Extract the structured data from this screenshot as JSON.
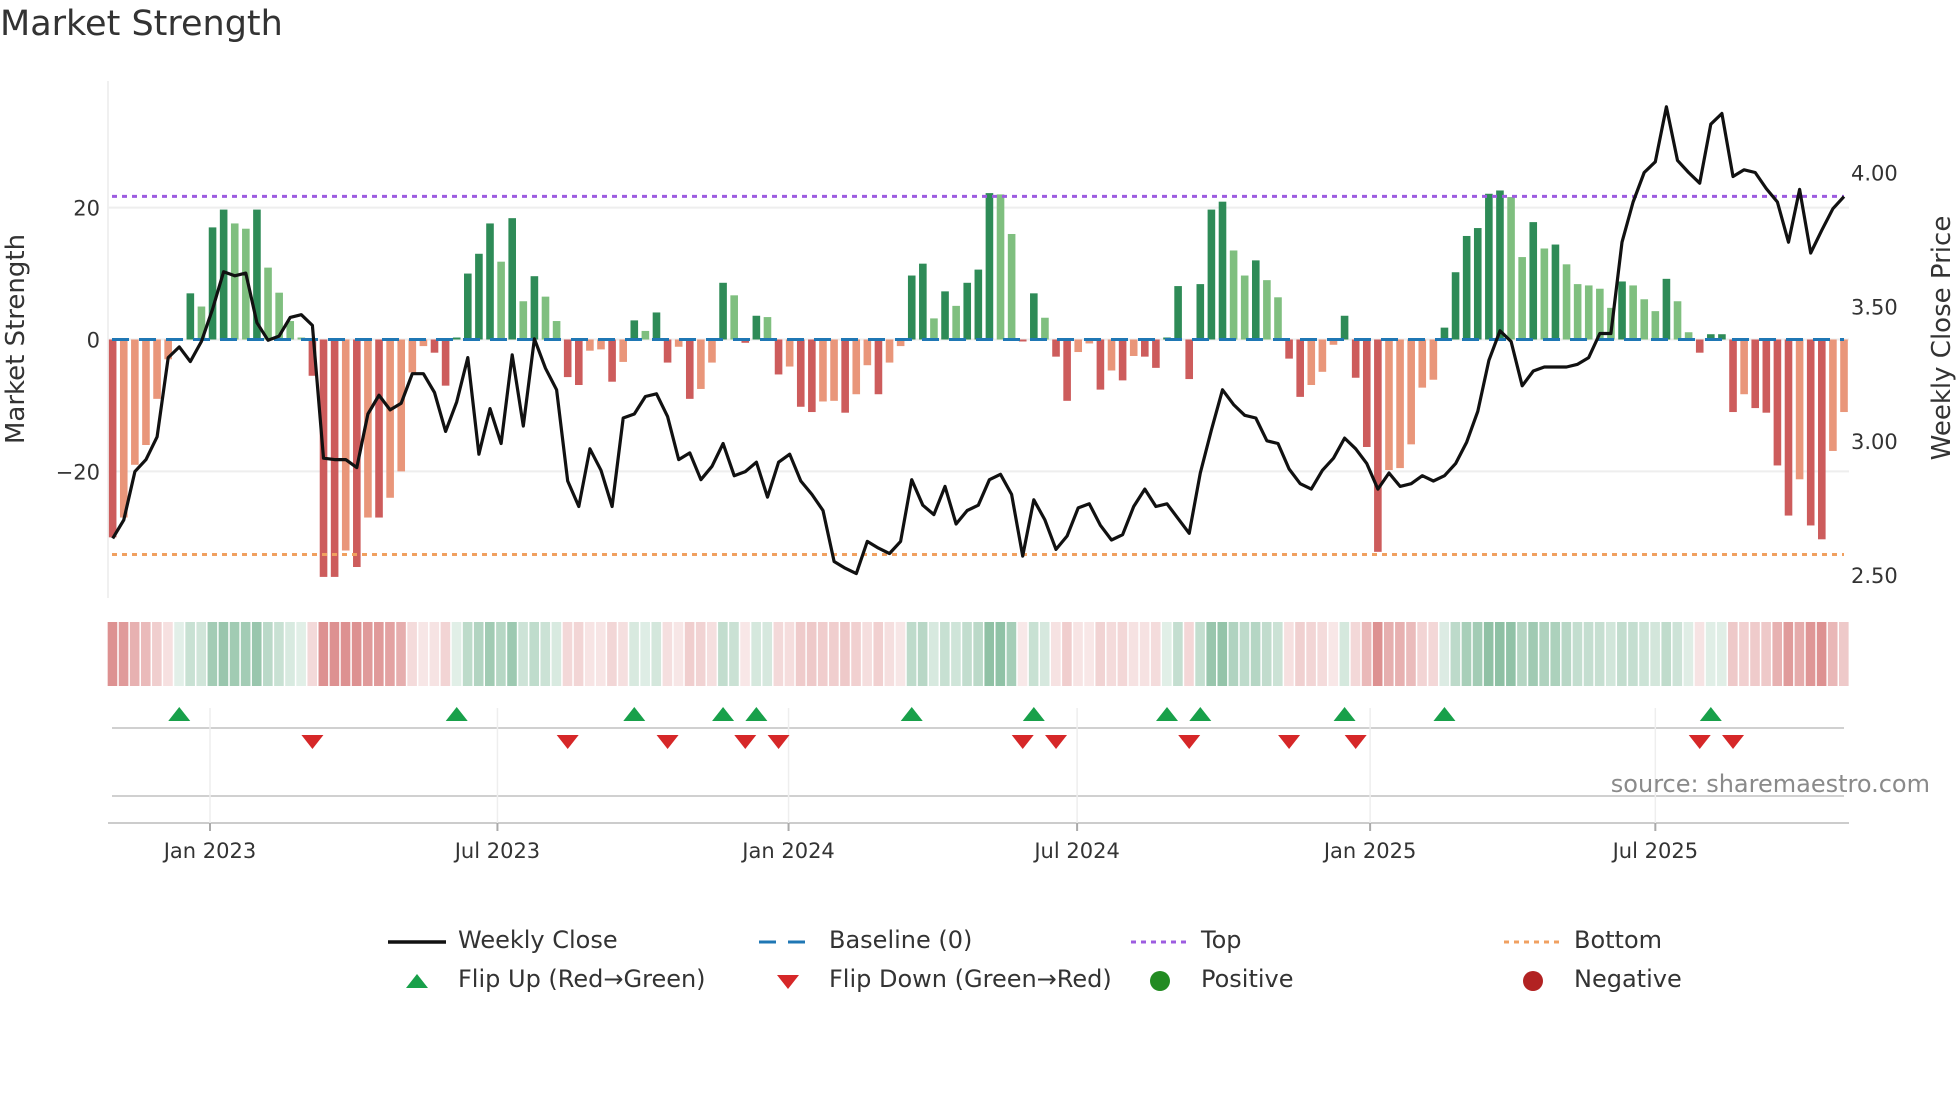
{
  "title": "Market Strength",
  "source": "source: sharemaestro.com",
  "colors": {
    "pos_strong": "#2e8b57",
    "pos_weak": "#7fbf7f",
    "neg_strong": "#cd5c5c",
    "neg_weak": "#e9967a",
    "line": "#111111",
    "baseline": "#1f77b4",
    "top": "#9d5ce0",
    "bottom": "#f0a060",
    "flip_up": "#18a04a",
    "flip_down": "#d62728",
    "positive": "#228b22",
    "negative": "#b22222"
  },
  "legend": [
    {
      "label": "Weekly Close",
      "kind": "line"
    },
    {
      "label": "Baseline (0)",
      "kind": "baseline"
    },
    {
      "label": "Top",
      "kind": "top"
    },
    {
      "label": "Bottom",
      "kind": "bottom"
    },
    {
      "label": "Flip Up (Red→Green)",
      "kind": "up"
    },
    {
      "label": "Flip Down (Green→Red)",
      "kind": "down"
    },
    {
      "label": "Positive",
      "kind": "pos"
    },
    {
      "label": "Negative",
      "kind": "neg"
    }
  ],
  "chart_data": {
    "type": "bar",
    "title": "Market Strength",
    "ylabel": "Market Strength",
    "ylabel_right": "Weekly Close Price",
    "ylim": [
      -39.2,
      39.2
    ],
    "ylim_right": [
      2.414,
      4.341
    ],
    "xlim_week_index": [
      -0.42,
      156.45
    ],
    "yticks": [
      {
        "v": 20,
        "label": "20"
      },
      {
        "v": 0,
        "label": "0"
      },
      {
        "v": -20,
        "label": "−20"
      }
    ],
    "yticks_right": [
      {
        "v": 4.0,
        "label": "4.00"
      },
      {
        "v": 3.5,
        "label": "3.50"
      },
      {
        "v": 3.0,
        "label": "3.00"
      },
      {
        "v": 2.5,
        "label": "2.50"
      }
    ],
    "xticks": [
      {
        "week": 8.77,
        "label": "Jan 2023"
      },
      {
        "week": 34.67,
        "label": "Jul 2023"
      },
      {
        "week": 60.9,
        "label": "Jan 2024"
      },
      {
        "week": 86.9,
        "label": "Jul 2024"
      },
      {
        "week": 113.3,
        "label": "Jan 2025"
      },
      {
        "week": 139.0,
        "label": "Jul 2025"
      }
    ],
    "baseline": 0,
    "top_level": 21.7,
    "bottom_level": -32.6,
    "grid": true,
    "legend_position": "bottom",
    "strength": [
      -30,
      -27,
      -19,
      -16,
      -9,
      -3,
      0.2,
      7,
      5,
      17,
      19.7,
      17.6,
      16.8,
      19.7,
      10.9,
      7.1,
      2.8,
      0.3,
      -5.5,
      -36,
      -36,
      -32,
      -34.5,
      -27,
      -27,
      -24,
      -20,
      -5,
      -1,
      -2,
      -7,
      0.3,
      10,
      13,
      17.6,
      11.8,
      18.4,
      5.8,
      9.6,
      6.5,
      2.8,
      -5.7,
      -6.9,
      -1.7,
      -1.5,
      -6.4,
      -3.4,
      2.9,
      1.3,
      4.1,
      -3.5,
      -1.1,
      -9,
      -7.5,
      -3.5,
      8.6,
      6.7,
      -0.5,
      3.6,
      3.4,
      -5.3,
      -4.1,
      -10.2,
      -11,
      -9.4,
      -9.3,
      -11.1,
      -8.3,
      -3.9,
      -8.3,
      -3.5,
      -1,
      9.7,
      11.5,
      3.2,
      7.3,
      5.1,
      8.6,
      10.6,
      22.2,
      22,
      16,
      -0.3,
      7,
      3.3,
      -2.6,
      -9.3,
      -1.9,
      -0.6,
      -7.6,
      -4.7,
      -6.2,
      -2.5,
      -2.6,
      -4.3,
      0.3,
      8.1,
      -6,
      8.4,
      19.7,
      20.9,
      13.5,
      9.7,
      12,
      9,
      6.4,
      -2.9,
      -8.7,
      -6.9,
      -4.9,
      -0.8,
      3.6,
      -5.8,
      -16.3,
      -32.2,
      -19.8,
      -19.5,
      -15.9,
      -7.3,
      -6.1,
      1.8,
      10.2,
      15.7,
      16.9,
      22.1,
      22.6,
      21.6,
      12.5,
      17.8,
      13.8,
      14.4,
      11.4,
      8.4,
      8.2,
      7.7,
      4.8,
      8.8,
      8.2,
      6.1,
      4.3,
      9.2,
      5.8,
      1.1,
      -2,
      0.8,
      0.8,
      -11,
      -8.3,
      -10.4,
      -11.1,
      -19.1,
      -26.7,
      -21.2,
      -28.2,
      -30.3,
      -16.9,
      -11
    ],
    "weekly_close": [
      2.636,
      2.705,
      2.885,
      2.93,
      3.015,
      3.31,
      3.35,
      3.295,
      3.37,
      3.49,
      3.63,
      3.615,
      3.625,
      3.44,
      3.375,
      3.39,
      3.46,
      3.47,
      3.43,
      2.935,
      2.93,
      2.93,
      2.9,
      3.1,
      3.17,
      3.115,
      3.14,
      3.25,
      3.25,
      3.18,
      3.035,
      3.145,
      3.31,
      2.95,
      3.12,
      2.99,
      3.32,
      3.055,
      3.38,
      3.27,
      3.19,
      2.85,
      2.755,
      2.97,
      2.89,
      2.755,
      3.085,
      3.1,
      3.165,
      3.175,
      3.09,
      2.93,
      2.955,
      2.855,
      2.905,
      2.99,
      2.87,
      2.885,
      2.92,
      2.79,
      2.92,
      2.95,
      2.85,
      2.8,
      2.74,
      2.55,
      2.525,
      2.505,
      2.625,
      2.6,
      2.58,
      2.625,
      2.855,
      2.76,
      2.725,
      2.83,
      2.69,
      2.74,
      2.76,
      2.855,
      2.875,
      2.8,
      2.57,
      2.78,
      2.705,
      2.595,
      2.645,
      2.75,
      2.765,
      2.685,
      2.63,
      2.65,
      2.755,
      2.82,
      2.755,
      2.765,
      2.71,
      2.655,
      2.88,
      3.04,
      3.19,
      3.135,
      3.095,
      3.085,
      3.0,
      2.99,
      2.895,
      2.84,
      2.82,
      2.89,
      2.935,
      3.01,
      2.97,
      2.915,
      2.82,
      2.88,
      2.83,
      2.84,
      2.87,
      2.85,
      2.87,
      2.915,
      2.995,
      3.11,
      3.3,
      3.41,
      3.37,
      3.205,
      3.26,
      3.275,
      3.275,
      3.275,
      3.285,
      3.31,
      3.4,
      3.4,
      3.74,
      3.89,
      4.0,
      4.04,
      4.245,
      4.045,
      4.0,
      3.96,
      4.18,
      4.22,
      3.985,
      4.01,
      4.0,
      3.94,
      3.89,
      3.74,
      3.937,
      3.7,
      3.785,
      3.865,
      3.91
    ]
  }
}
